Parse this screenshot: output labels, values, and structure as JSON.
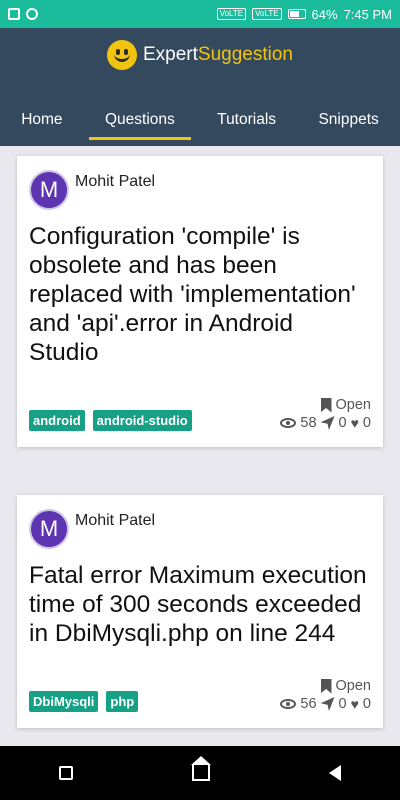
{
  "status_bar": {
    "battery": "64%",
    "time": "7:45 PM",
    "volte1": "VoLTE",
    "volte2": "VoLTE"
  },
  "brand": {
    "part1": "Expert",
    "part2": "Suggestion"
  },
  "nav": {
    "tabs": [
      "Home",
      "Questions",
      "Tutorials",
      "Snippets"
    ],
    "active": "Questions"
  },
  "questions": [
    {
      "avatar": "M",
      "author": "Mohit Patel",
      "title": "Configuration 'compile' is obsolete and has been replaced with 'implementation' and 'api'.error in Android Studio",
      "tags": [
        "android",
        "android-studio"
      ],
      "status": "Open",
      "views": "58",
      "answers": "0",
      "likes": "0"
    },
    {
      "avatar": "M",
      "author": "Mohit Patel",
      "title": "Fatal error Maximum execution time of 300 seconds exceeded in DbiMysqli.php on line 244",
      "tags": [
        "DbiMysqli",
        "php"
      ],
      "status": "Open",
      "views": "56",
      "answers": "0",
      "likes": "0"
    }
  ],
  "colors": {
    "header": "#34495e",
    "accent": "#f1c40f",
    "status_bar": "#1abc9c",
    "tag": "#16a085",
    "avatar": "#5e35b1"
  }
}
